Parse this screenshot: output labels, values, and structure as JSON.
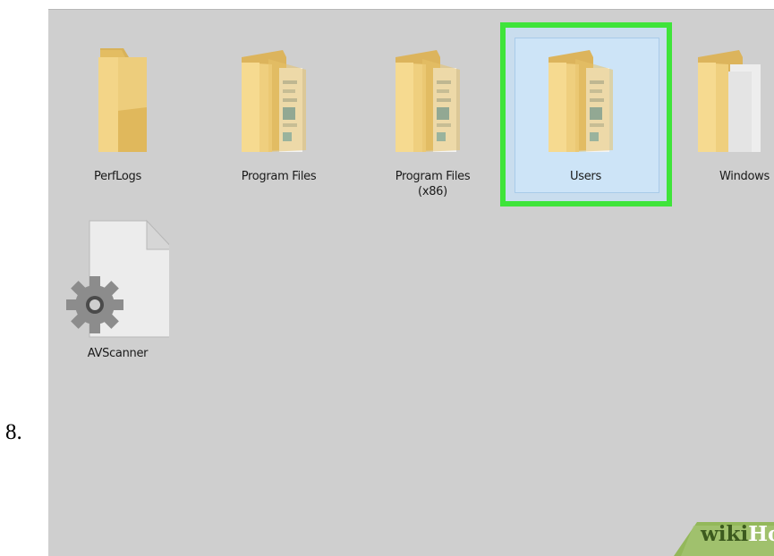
{
  "step_number": "8.",
  "items": [
    {
      "name": "PerfLogs",
      "type": "folder-empty"
    },
    {
      "name": "Program Files",
      "type": "folder-documents"
    },
    {
      "name": "Program Files (x86)",
      "label_line1": "Program Files",
      "label_line2": "(x86)",
      "type": "folder-documents"
    },
    {
      "name": "Users",
      "type": "folder-documents",
      "selected": true
    },
    {
      "name": "Windows",
      "type": "folder-documents"
    },
    {
      "name": "AVScanner",
      "type": "system-file"
    }
  ],
  "colors": {
    "highlight_border": "#3fe43a",
    "selection_fill": "#cde4f7",
    "folder": "#e8c36a",
    "background": "#cfcfcf"
  },
  "watermark": {
    "part1": "wiki",
    "part2": "How"
  }
}
